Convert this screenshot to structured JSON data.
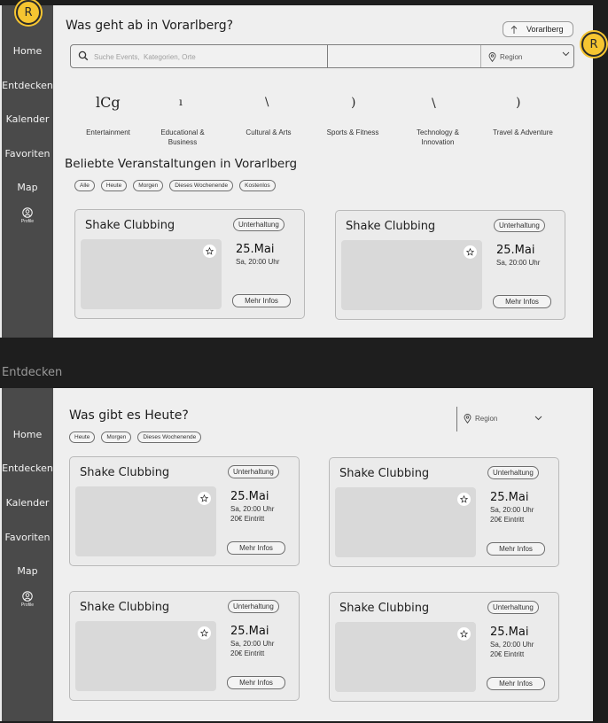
{
  "nav": {
    "items": [
      "Home",
      "Entdecken",
      "Kalender",
      "Favoriten",
      "Map"
    ],
    "profile_label": "Profile"
  },
  "avatar_letter": "R",
  "screen1": {
    "title": "Was geht ab in Vorarlberg?",
    "region_button": "Vorarlberg",
    "search_placeholder": "Suche Events,  Kategorien, Orte",
    "region_select": "Region",
    "category_glyphs": [
      "lCg",
      "ı",
      "\\",
      ")",
      "\\",
      ")"
    ],
    "categories": [
      {
        "line1": "Entertainment",
        "line2": ""
      },
      {
        "line1": "Educational &",
        "line2": "Business"
      },
      {
        "line1": "Cultural & Arts",
        "line2": ""
      },
      {
        "line1": "Sports & Fitness",
        "line2": ""
      },
      {
        "line1": "Technology &",
        "line2": "Innovation"
      },
      {
        "line1": "Travel & Adventure",
        "line2": ""
      }
    ],
    "section_title": "Beliebte Veranstaltungen in Vorarlberg",
    "filters": [
      "Alle",
      "Heute",
      "Morgen",
      "Dieses Wochenende",
      "Kostenlos"
    ],
    "cards": [
      {
        "title": "Shake Clubbing",
        "tag": "Unterhaltung",
        "date": "25.Mai",
        "time": "Sa, 20:00 Uhr",
        "button": "Mehr Infos"
      },
      {
        "title": "Shake Clubbing",
        "tag": "Unterhaltung",
        "date": "25.Mai",
        "time": "Sa, 20:00 Uhr",
        "button": "Mehr Infos"
      }
    ]
  },
  "between_label": "Entdecken",
  "screen2": {
    "title": "Was gibt es Heute?",
    "region_select": "Region",
    "filters": [
      "Heute",
      "Morgen",
      "Dieses Wochenende"
    ],
    "cards": [
      {
        "title": "Shake Clubbing",
        "tag": "Unterhaltung",
        "date": "25.Mai",
        "time": "Sa, 20:00 Uhr",
        "price": "20€ Eintritt",
        "button": "Mehr Infos"
      },
      {
        "title": "Shake Clubbing",
        "tag": "Unterhaltung",
        "date": "25.Mai",
        "time": "Sa, 20:00 Uhr",
        "price": "20€ Eintritt",
        "button": "Mehr Infos"
      },
      {
        "title": "Shake Clubbing",
        "tag": "Unterhaltung",
        "date": "25.Mai",
        "time": "Sa, 20:00 Uhr",
        "price": "20€ Eintritt",
        "button": "Mehr Infos"
      },
      {
        "title": "Shake Clubbing",
        "tag": "Unterhaltung",
        "date": "25.Mai",
        "time": "Sa, 20:00 Uhr",
        "price": "20€ Eintritt",
        "button": "Mehr Infos"
      }
    ]
  },
  "colors": {
    "avatar": "#f6c531",
    "sidebar": "#4a4a4a",
    "background": "#1e1e1e",
    "canvas": "#efefef"
  }
}
